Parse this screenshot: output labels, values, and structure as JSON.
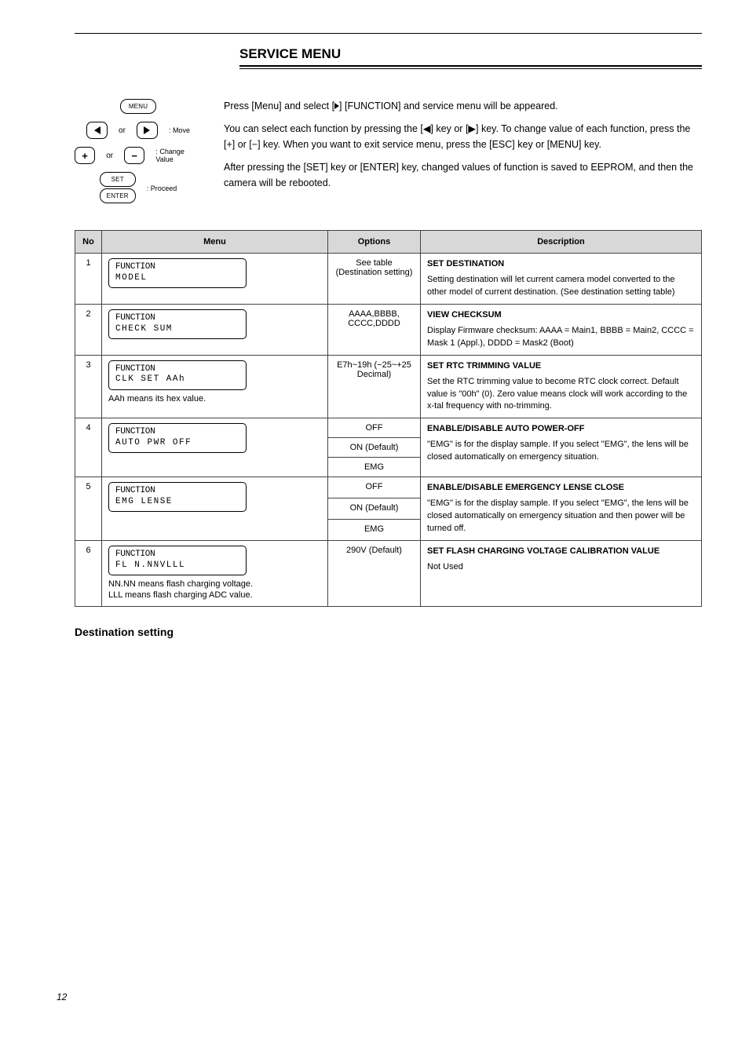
{
  "header": {
    "title": "SERVICE MENU"
  },
  "buttons": {
    "menu": "MENU",
    "left_aria": "left-arrow",
    "right_aria": "right-arrow",
    "move_label": ": Move",
    "plus": "+",
    "minus": "−",
    "plus_minus_label": ": Change Value",
    "or": "or",
    "set": "SET",
    "enter": "ENTER",
    "enter_label": ": Proceed"
  },
  "intro": {
    "p1_prefix": "Press [Menu] and select [",
    "p1_mid": "] [",
    "p1_item": "FUNCTION",
    "p1_after": "] and service menu will be appeared.",
    "p2": "You can select each function by pressing the [◀] key or [▶] key. To change value of each function, press the [+] or [−] key. When you want to exit service menu, press the [ESC] key or [MENU] key.",
    "p3": "After pressing the [SET] key or [ENTER] key, changed values of function is saved to EEPROM, and then the camera will be rebooted."
  },
  "table": {
    "headers": {
      "no": "No",
      "menu": "Menu",
      "options": "Options",
      "description": "Description"
    },
    "rows": [
      {
        "no": "1",
        "lcd_l1": "FUNCTION",
        "lcd_l2": "MODEL",
        "note": "",
        "options": [
          "See table (Destination setting)"
        ],
        "desc_title": "SET DESTINATION",
        "desc_body": "Setting destination will let current camera model converted to the other model of current destination. (See destination setting table)"
      },
      {
        "no": "2",
        "lcd_l1": "FUNCTION",
        "lcd_l2": "CHECK SUM",
        "note": "",
        "options": [
          "AAAA,BBBB, CCCC,DDDD"
        ],
        "desc_title": "VIEW CHECKSUM",
        "desc_body": "Display Firmware checksum: AAAA = Main1, BBBB = Main2, CCCC = Mask 1 (Appl.), DDDD = Mask2 (Boot)"
      },
      {
        "no": "3",
        "lcd_l1": "FUNCTION",
        "lcd_l2": "CLK SET AAh",
        "note": "AAh means its hex value.",
        "options": [
          "E7h~19h (−25~+25 Decimal)"
        ],
        "desc_title": "SET RTC TRIMMING VALUE",
        "desc_body": "Set the RTC trimming value to become RTC clock correct. Default value is \"00h\" (0). Zero value means clock will work according to the x-tal frequency with no-trimming."
      },
      {
        "no": "4",
        "lcd_l1": "FUNCTION",
        "lcd_l2": "AUTO PWR OFF",
        "note": "",
        "options": [
          "OFF",
          "ON (Default)",
          "EMG"
        ],
        "desc_title": "ENABLE/DISABLE AUTO POWER-OFF",
        "desc_body": "\"EMG\" is for the display sample. If you select \"EMG\", the lens will be closed automatically on emergency situation."
      },
      {
        "no": "5",
        "lcd_l1": "FUNCTION",
        "lcd_l2": "EMG LENSE",
        "note": "",
        "options": [
          "OFF",
          "ON (Default)",
          "EMG"
        ],
        "desc_title": "ENABLE/DISABLE EMERGENCY LENSE CLOSE",
        "desc_body": "\"EMG\" is for the display sample. If you select \"EMG\", the lens will be closed automatically on emergency situation and then power will be turned off."
      },
      {
        "no": "6",
        "lcd_l1": "FUNCTION",
        "lcd_l2": "FL  N.NNVLLL",
        "note_html": "NN.NN means flash charging voltage.<br>LLL means flash charging ADC value.",
        "options": [
          "290V (Default)"
        ],
        "desc_title": "SET FLASH CHARGING VOLTAGE CALIBRATION VALUE",
        "desc_body": "Not Used"
      }
    ]
  },
  "section2": "Destination setting",
  "page_no": "12"
}
